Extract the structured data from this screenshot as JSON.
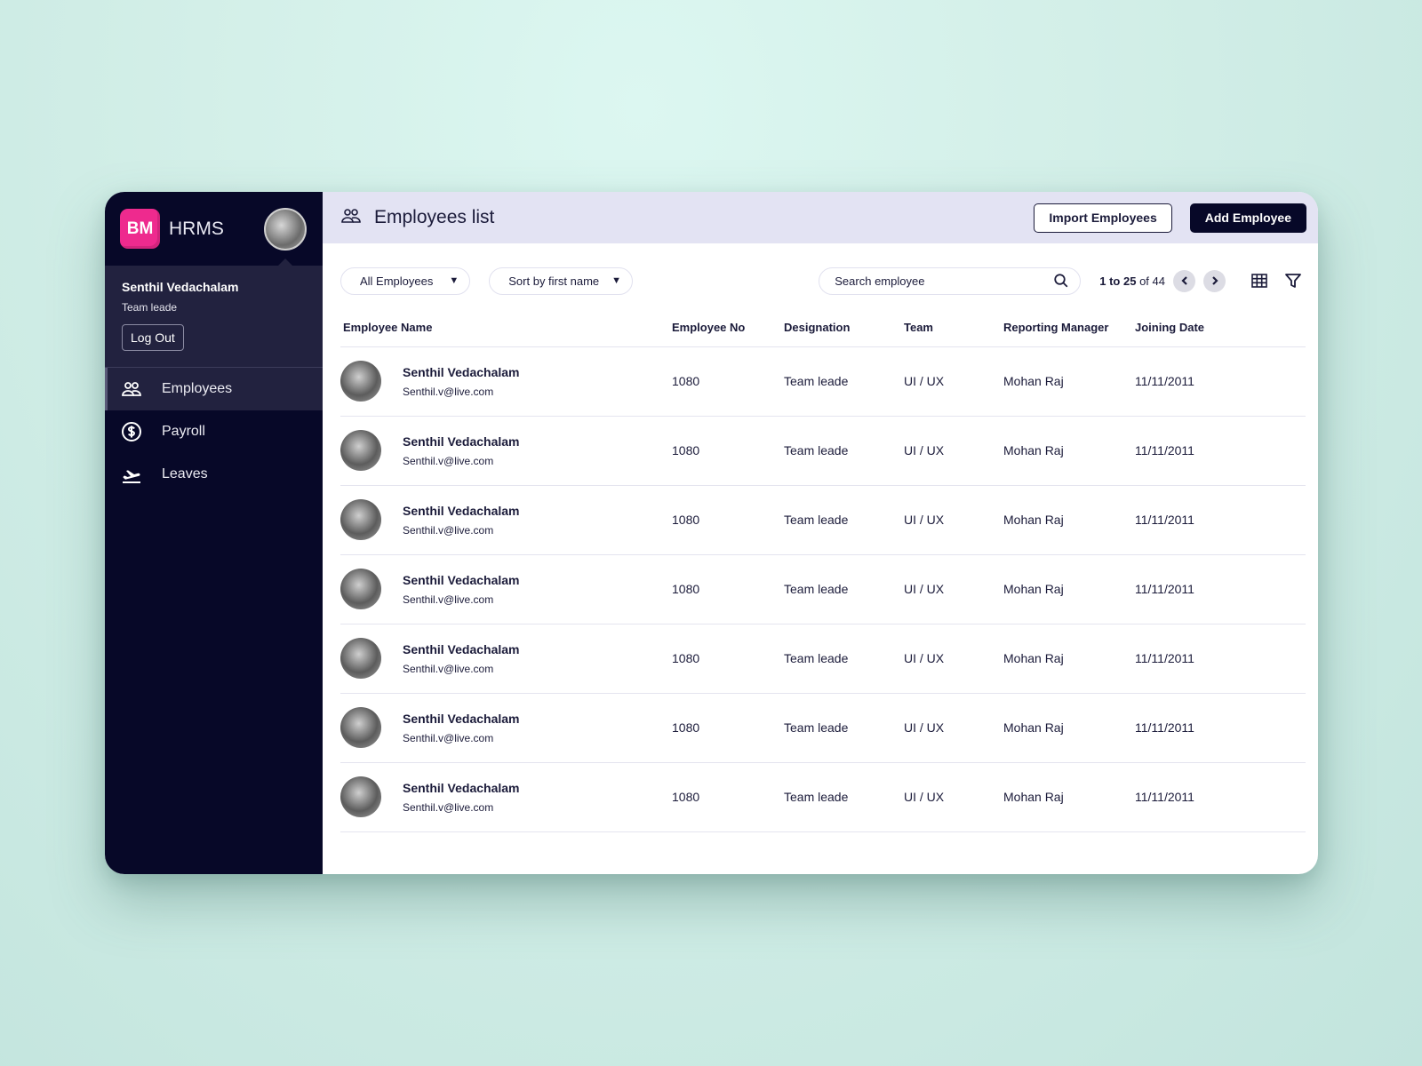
{
  "app": {
    "logo": "BM",
    "name": "HRMS"
  },
  "profile": {
    "name": "Senthil Vedachalam",
    "role": "Team leade",
    "logout_label": "Log Out"
  },
  "nav": [
    {
      "label": "Employees",
      "icon": "users-icon",
      "active": true
    },
    {
      "label": "Payroll",
      "icon": "dollar-circle-icon",
      "active": false
    },
    {
      "label": "Leaves",
      "icon": "plane-departure-icon",
      "active": false
    }
  ],
  "header": {
    "title": "Employees list",
    "import_label": "Import Employees",
    "add_label": "Add Employee"
  },
  "toolbar": {
    "filter_value": "All Employees",
    "sort_value": "Sort by first name",
    "search_placeholder": "Search employee",
    "pager": {
      "range": "1 to 25",
      "of_label": "of 44"
    }
  },
  "table": {
    "columns": [
      "Employee Name",
      "Employee No",
      "Designation",
      "Team",
      "Reporting Manager",
      "Joining Date"
    ],
    "rows": [
      {
        "name": "Senthil Vedachalam",
        "email": "Senthil.v@live.com",
        "no": "1080",
        "designation": "Team leade",
        "team": "UI / UX",
        "manager": "Mohan Raj",
        "date": "11/11/2011"
      },
      {
        "name": "Senthil Vedachalam",
        "email": "Senthil.v@live.com",
        "no": "1080",
        "designation": "Team leade",
        "team": "UI / UX",
        "manager": "Mohan Raj",
        "date": "11/11/2011"
      },
      {
        "name": "Senthil Vedachalam",
        "email": "Senthil.v@live.com",
        "no": "1080",
        "designation": "Team leade",
        "team": "UI / UX",
        "manager": "Mohan Raj",
        "date": "11/11/2011"
      },
      {
        "name": "Senthil Vedachalam",
        "email": "Senthil.v@live.com",
        "no": "1080",
        "designation": "Team leade",
        "team": "UI / UX",
        "manager": "Mohan Raj",
        "date": "11/11/2011"
      },
      {
        "name": "Senthil Vedachalam",
        "email": "Senthil.v@live.com",
        "no": "1080",
        "designation": "Team leade",
        "team": "UI / UX",
        "manager": "Mohan Raj",
        "date": "11/11/2011"
      },
      {
        "name": "Senthil Vedachalam",
        "email": "Senthil.v@live.com",
        "no": "1080",
        "designation": "Team leade",
        "team": "UI / UX",
        "manager": "Mohan Raj",
        "date": "11/11/2011"
      },
      {
        "name": "Senthil Vedachalam",
        "email": "Senthil.v@live.com",
        "no": "1080",
        "designation": "Team leade",
        "team": "UI / UX",
        "manager": "Mohan Raj",
        "date": "11/11/2011"
      }
    ]
  },
  "colors": {
    "sidebar": "#070828",
    "accent": "#ee2a8e",
    "header_bg": "#e3e3f3"
  }
}
